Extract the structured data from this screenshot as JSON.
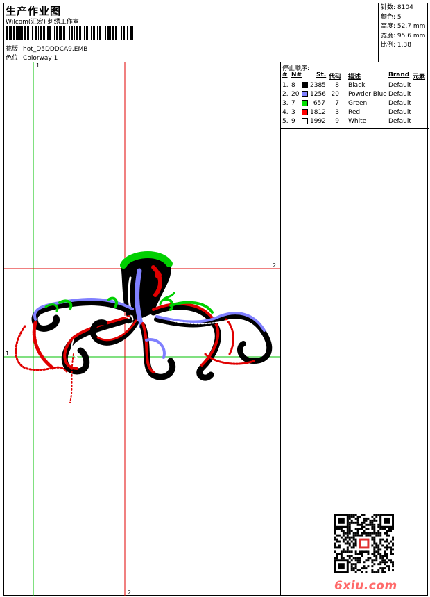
{
  "header": {
    "title": "生产作业图",
    "company": "Wilcom(汇宏) 刺绣工作室",
    "design_label": "花版:",
    "design_value": "hot_D5DDDCA9.EMB",
    "colorway_label": "色位:",
    "colorway_value": "Colorway 1"
  },
  "stats": [
    {
      "label": "针数:",
      "value": "8104"
    },
    {
      "label": "颜色:",
      "value": "5"
    },
    {
      "label": "高度:",
      "value": "52.7 mm"
    },
    {
      "label": "宽度:",
      "value": "95.6 mm"
    },
    {
      "label": "比例:",
      "value": "1.38"
    }
  ],
  "color_table": {
    "title": "停止顺序:",
    "headers": {
      "hash": "#",
      "n": "N#",
      "st": "St.",
      "code": "代码",
      "desc": "描述",
      "brand": "Brand",
      "element": "元素"
    },
    "rows": [
      {
        "idx": "1.",
        "n": "8",
        "color": "#000000",
        "st": "2385",
        "code": "8",
        "desc": "Black",
        "brand": "Default"
      },
      {
        "idx": "2.",
        "n": "20",
        "color": "#8080ff",
        "st": "1256",
        "code": "20",
        "desc": "Powder Blue",
        "brand": "Default"
      },
      {
        "idx": "3.",
        "n": "7",
        "color": "#00e000",
        "st": "657",
        "code": "7",
        "desc": "Green",
        "brand": "Default"
      },
      {
        "idx": "4.",
        "n": "3",
        "color": "#ff0000",
        "st": "1812",
        "code": "3",
        "desc": "Red",
        "brand": "Default"
      },
      {
        "idx": "5.",
        "n": "9",
        "color": "#ffffff",
        "st": "1992",
        "code": "9",
        "desc": "White",
        "brand": "Default"
      }
    ]
  },
  "axes": {
    "top_label": "1",
    "left_label": "1",
    "right_label": "2",
    "bottom_label": "2"
  },
  "watermark": "6xiu.com",
  "colors": {
    "axis_red": "#e00000",
    "axis_green": "#00c000",
    "watermark": "#ff6a6a"
  }
}
